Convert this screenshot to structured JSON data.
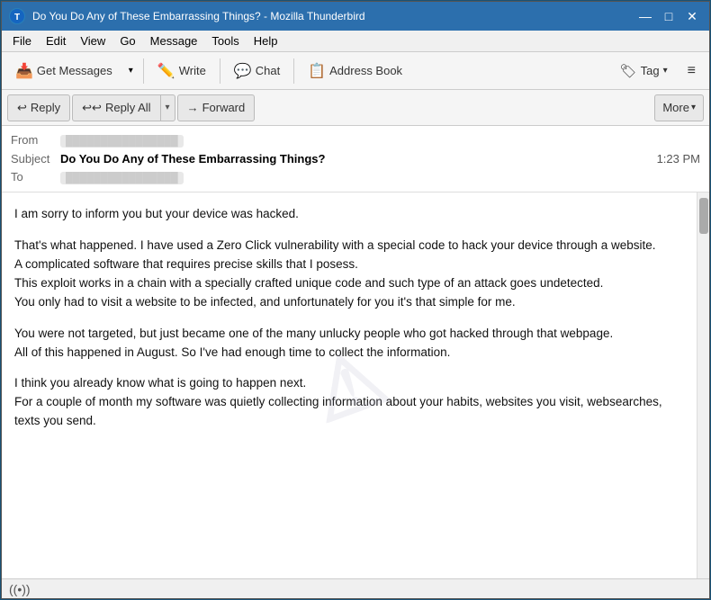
{
  "window": {
    "title": "Do You Do Any of These Embarrassing Things? - Mozilla Thunderbird",
    "icon": "T"
  },
  "title_controls": {
    "minimize": "—",
    "maximize": "□",
    "close": "✕"
  },
  "menu": {
    "items": [
      "File",
      "Edit",
      "View",
      "Go",
      "Message",
      "Tools",
      "Help"
    ]
  },
  "toolbar": {
    "get_messages_label": "Get Messages",
    "write_label": "Write",
    "chat_label": "Chat",
    "address_book_label": "Address Book",
    "tag_label": "Tag",
    "dropdown_arrow": "▾",
    "hamburger": "≡"
  },
  "action_bar": {
    "reply_label": "Reply",
    "reply_all_label": "Reply All",
    "forward_label": "Forward",
    "more_label": "More",
    "more_arrow": "▾"
  },
  "email": {
    "from_label": "From",
    "from_address": "████████████████",
    "subject_label": "Subject",
    "subject_text": "Do You Do Any of These Embarrassing Things?",
    "time": "1:23 PM",
    "to_label": "To",
    "to_address": "████████████████"
  },
  "body": {
    "paragraphs": [
      "I am sorry to inform you but your device was hacked.",
      "That's what happened. I have used a Zero Click vulnerability with a special code to hack your device through a website.\nA complicated software that requires precise skills that I posess.\nThis exploit works in a chain with a specially crafted unique code and such type of an attack goes undetected.\nYou only had to visit a website to be infected, and unfortunately for you it's that simple for me.",
      "You were not targeted, but just became one of the many unlucky people who got hacked through that webpage.\nAll of this happened in August. So I've had enough time to collect the information.",
      "I think you already know what is going to happen next.\nFor a couple of month my software was quietly collecting information about your habits, websites you visit, websearches, texts you send."
    ]
  },
  "status_bar": {
    "icon": "((•))"
  }
}
